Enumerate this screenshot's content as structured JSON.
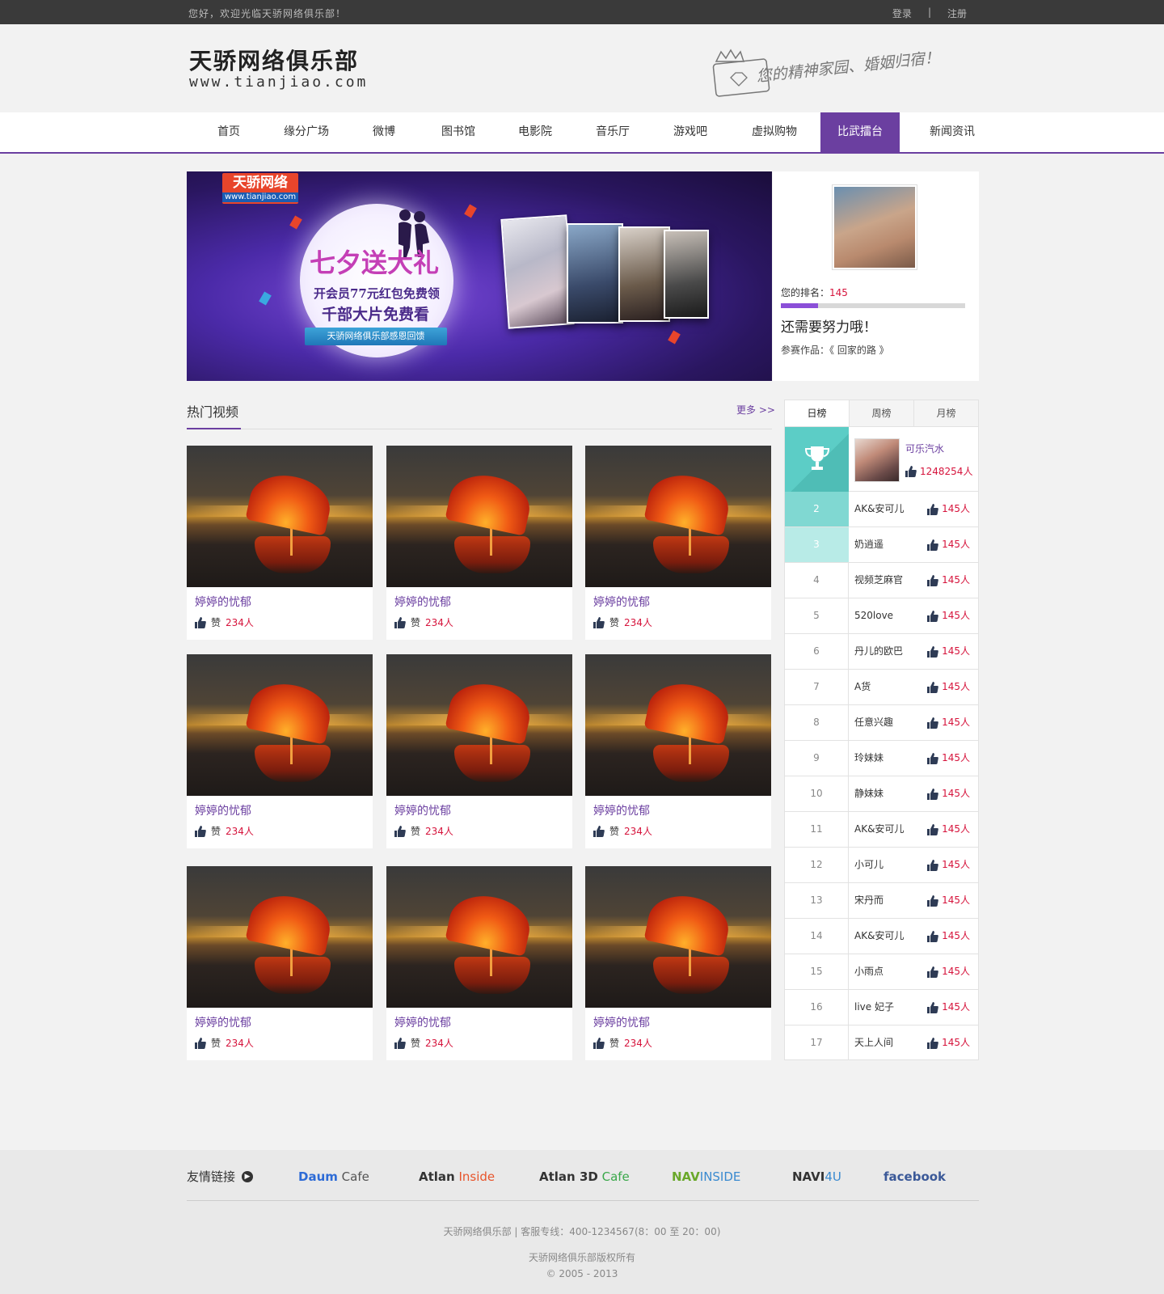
{
  "topbar": {
    "welcome": "您好，欢迎光临天骄网络俱乐部！",
    "login": "登录",
    "sep": "|",
    "register": "注册"
  },
  "header": {
    "logo_cn": "天骄网络俱乐部",
    "logo_en": "www.tianjiao.com",
    "slogan": "您的精神家园、婚姻归宿！"
  },
  "nav": [
    {
      "label": "首页"
    },
    {
      "label": "缘分广场"
    },
    {
      "label": "微博"
    },
    {
      "label": "图书馆"
    },
    {
      "label": "电影院"
    },
    {
      "label": "音乐厅"
    },
    {
      "label": "游戏吧"
    },
    {
      "label": "虚拟购物"
    },
    {
      "label": "比武擂台",
      "active": true
    },
    {
      "label": "新闻资讯"
    }
  ],
  "banner": {
    "brand": "天骄网络",
    "brand_sub": "www.tianjiao.com",
    "headline": "七夕送大礼",
    "line1": "开会员77元红包免费领",
    "line2": "千部大片免费看",
    "ribbon": "天骄网络俱乐部感恩回馈"
  },
  "profile": {
    "rank_label": "您的排名：",
    "rank_value": "145",
    "progress": 0.2,
    "encourage": "还需要努力哦！",
    "work_label": "参赛作品：",
    "work_title": "《 回家的路 》"
  },
  "hot": {
    "title": "热门视频",
    "more": "更多 >>",
    "videos": [
      {
        "title": "婷婷的忧郁",
        "like_label": "赞",
        "likes": "234人"
      },
      {
        "title": "婷婷的忧郁",
        "like_label": "赞",
        "likes": "234人"
      },
      {
        "title": "婷婷的忧郁",
        "like_label": "赞",
        "likes": "234人"
      },
      {
        "title": "婷婷的忧郁",
        "like_label": "赞",
        "likes": "234人"
      },
      {
        "title": "婷婷的忧郁",
        "like_label": "赞",
        "likes": "234人"
      },
      {
        "title": "婷婷的忧郁",
        "like_label": "赞",
        "likes": "234人"
      },
      {
        "title": "婷婷的忧郁",
        "like_label": "赞",
        "likes": "234人"
      },
      {
        "title": "婷婷的忧郁",
        "like_label": "赞",
        "likes": "234人"
      },
      {
        "title": "婷婷的忧郁",
        "like_label": "赞",
        "likes": "234人"
      }
    ]
  },
  "ranking": {
    "tabs": [
      "日榜",
      "周榜",
      "月榜"
    ],
    "top1": {
      "name": "可乐汽水",
      "likes": "1248254人",
      "icon": "trophy-icon"
    },
    "rows": [
      {
        "idx": "2",
        "name": "AK&安可儿",
        "likes": "145人"
      },
      {
        "idx": "3",
        "name": "奶逍遥",
        "likes": "145人"
      },
      {
        "idx": "4",
        "name": "视频芝麻官",
        "likes": "145人"
      },
      {
        "idx": "5",
        "name": "520love",
        "likes": "145人"
      },
      {
        "idx": "6",
        "name": "丹儿的欧巴",
        "likes": "145人"
      },
      {
        "idx": "7",
        "name": "A货",
        "likes": "145人"
      },
      {
        "idx": "8",
        "name": "任意兴趣",
        "likes": "145人"
      },
      {
        "idx": "9",
        "name": "玲妹妹",
        "likes": "145人"
      },
      {
        "idx": "10",
        "name": "静妹妹",
        "likes": "145人"
      },
      {
        "idx": "11",
        "name": "AK&安可儿",
        "likes": "145人"
      },
      {
        "idx": "12",
        "name": "小可儿",
        "likes": "145人"
      },
      {
        "idx": "13",
        "name": "宋丹而",
        "likes": "145人"
      },
      {
        "idx": "14",
        "name": "AK&安可儿",
        "likes": "145人"
      },
      {
        "idx": "15",
        "name": "小雨点",
        "likes": "145人"
      },
      {
        "idx": "16",
        "name": "live 妃子",
        "likes": "145人"
      },
      {
        "idx": "17",
        "name": "天上人间",
        "likes": "145人"
      }
    ]
  },
  "footer": {
    "links_title": "友情链接",
    "links": [
      {
        "a": "Daum",
        "b": " Cafe",
        "color_a": "#2d6bd6",
        "color_b": "#555"
      },
      {
        "a": "Atlan",
        "b": " Inside",
        "color_a": "#333",
        "color_b": "#e8542b"
      },
      {
        "a": "Atlan 3D",
        "b": " Cafe",
        "color_a": "#333",
        "color_b": "#3aa84a"
      },
      {
        "a": "NAV",
        "b": "INSIDE",
        "color_a": "#6aa82a",
        "color_b": "#3a8ad0"
      },
      {
        "a": "NAVI",
        "b": "4U",
        "color_a": "#333",
        "color_b": "#3a8ad0"
      },
      {
        "a": "facebook",
        "b": "",
        "color_a": "#3b5998",
        "color_b": "#3b5998"
      }
    ],
    "contact": "天骄网络俱乐部  |   客服专线：400-1234567(8：00 至 20：00)",
    "copyright": "天骄网络俱乐部版权所有",
    "years": "© 2005 - 2013"
  },
  "colors": {
    "brand_purple": "#6b3fa0",
    "accent_red": "#d6143c",
    "teal": "#5ccdc6"
  }
}
